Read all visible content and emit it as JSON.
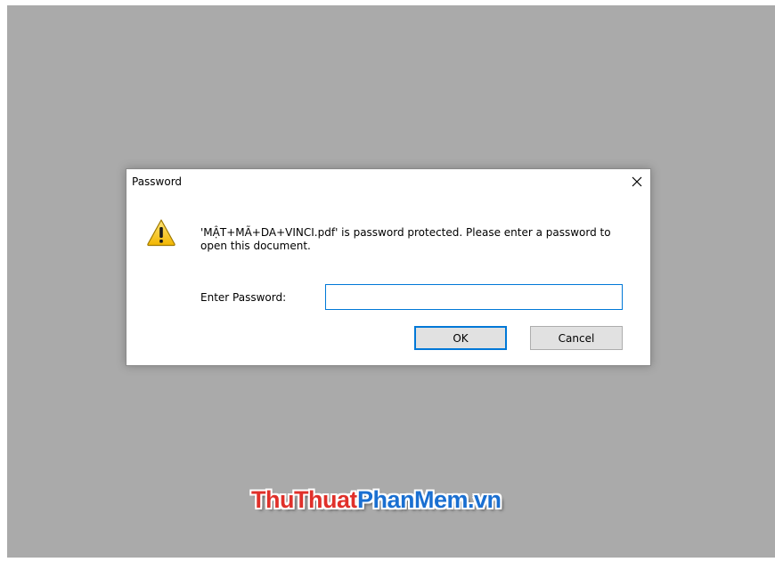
{
  "dialog": {
    "title": "Password",
    "message": "'MẬT+MÃ+DA+VINCI.pdf' is password protected. Please enter a password to open this document.",
    "password_label": "Enter Password:",
    "password_value": "",
    "ok_label": "OK",
    "cancel_label": "Cancel",
    "close_symbol": "✕"
  },
  "watermark": {
    "part1": "ThuThuat",
    "part2": "PhanMem.vn"
  },
  "icons": {
    "warning": "warning-icon",
    "close": "close-icon"
  },
  "colors": {
    "backdrop": "#aaaaaa",
    "focus_blue": "#0078d7",
    "warning_yellow": "#f5c518",
    "watermark_red": "#e0302a",
    "watermark_blue": "#1a6fd1"
  }
}
